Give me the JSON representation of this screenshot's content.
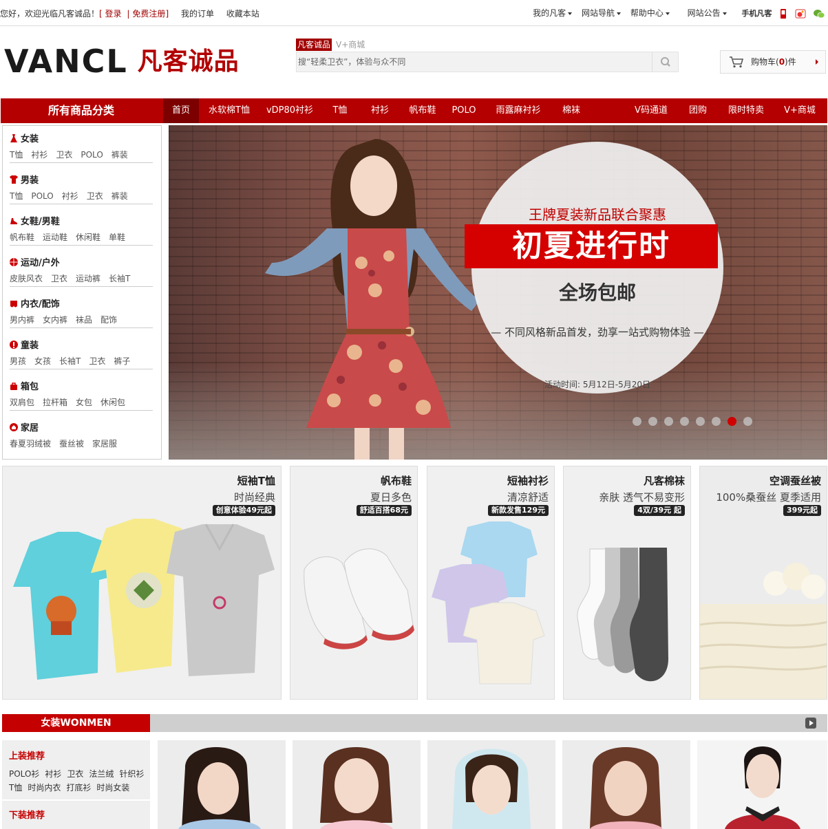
{
  "topbar": {
    "greeting": "您好，欢迎光临凡客诚品！",
    "bracket_open": "[",
    "login": "登录",
    "divider": "|",
    "register": "免费注册",
    "bracket_close": "]",
    "my_orders": "我的订单",
    "bookmark": "收藏本站",
    "my_vancl": "我的凡客",
    "site_nav": "网站导航",
    "help": "帮助中心",
    "announce": "网站公告",
    "mobile": "手机凡客"
  },
  "header": {
    "logo_en": "VANCL",
    "logo_cn": "凡客诚品",
    "search_tab_active": "凡客诚品",
    "search_tab_other": "V+商城",
    "search_placeholder": "搜“轻柔卫衣”，体验与众不同",
    "cart_prefix": "购物车(",
    "cart_count": "0",
    "cart_suffix": ")件"
  },
  "nav": {
    "all_categories": "所有商品分类",
    "items": [
      "首页",
      "水软棉T恤",
      "vDP80衬衫",
      "T恤",
      "衬衫",
      "帆布鞋",
      "POLO",
      "雨露麻衬衫",
      "棉袜",
      "V码通道",
      "团购",
      "限时特卖",
      "V+商城"
    ]
  },
  "categories": [
    {
      "title": "女装",
      "links": [
        "T恤",
        "衬衫",
        "卫衣",
        "POLO",
        "裤装"
      ]
    },
    {
      "title": "男装",
      "links": [
        "T恤",
        "POLO",
        "衬衫",
        "卫衣",
        "裤装"
      ]
    },
    {
      "title": "女鞋/男鞋",
      "links": [
        "帆布鞋",
        "运动鞋",
        "休闲鞋",
        "单鞋"
      ]
    },
    {
      "title": "运动/户外",
      "links": [
        "皮肤风衣",
        "卫衣",
        "运动裤",
        "长袖T"
      ]
    },
    {
      "title": "内衣/配饰",
      "links": [
        "男内裤",
        "女内裤",
        "袜品",
        "配饰"
      ]
    },
    {
      "title": "童装",
      "links": [
        "男孩",
        "女孩",
        "长袖T",
        "卫衣",
        "裤子"
      ]
    },
    {
      "title": "箱包",
      "links": [
        "双肩包",
        "拉杆箱",
        "女包",
        "休闲包"
      ]
    },
    {
      "title": "家居",
      "links": [
        "春夏羽绒被",
        "蚕丝被",
        "家居服"
      ]
    }
  ],
  "banner": {
    "headline_small": "王牌夏装新品联合聚惠",
    "headline_big": "初夏进行时",
    "free_shipping": "全场包邮",
    "tagline": "— 不同风格新品首发，劲享一站式购物体验 —",
    "dates": "活动时间: 5月12日-5月20日",
    "slide_count": 8,
    "active_slide": 7
  },
  "products": [
    {
      "name": "短袖T恤",
      "sub": "时尚经典",
      "tag": "创意体验49元起"
    },
    {
      "name": "帆布鞋",
      "sub": "夏日多色",
      "tag": "舒适百搭68元"
    },
    {
      "name": "短袖衬衫",
      "sub": "清凉舒适",
      "tag": "新款发售129元"
    },
    {
      "name": "凡客棉袜",
      "sub": "亲肤  透气不易变形",
      "tag": "4双/39元 起"
    },
    {
      "name": "空调蚕丝被",
      "sub": "100%桑蚕丝  夏季适用",
      "tag": "399元起"
    }
  ],
  "women": {
    "section_label": "女装WONMEN",
    "tops_title": "上装推荐",
    "tops_row1": [
      "POLO衫",
      "衬衫",
      "卫衣",
      "法兰绒",
      "针织衫"
    ],
    "tops_row2": [
      "T恤",
      "时尚内衣",
      "打底衫",
      "时尚女装"
    ],
    "bottoms_title": "下装推荐"
  },
  "colors": {
    "brand_red": "#b40001",
    "nav_active": "#7d0000",
    "dot_active": "#d00000"
  }
}
